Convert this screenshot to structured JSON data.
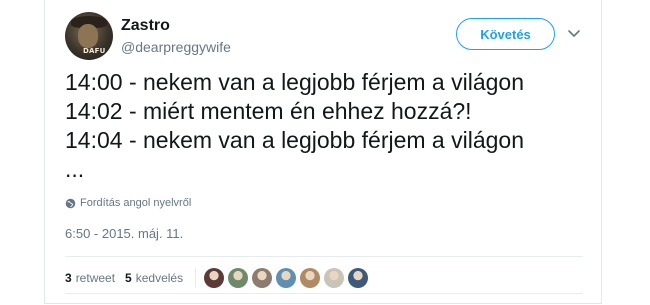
{
  "tweet": {
    "author": {
      "name": "Zastro",
      "handle": "@dearpreggywife",
      "avatar_label": "DAFU"
    },
    "follow_label": "Követés",
    "lines": [
      "14:00 - nekem van a legjobb férjem a világon",
      "14:02 - miért mentem én ehhez hozzá?!",
      "14:04 - nekem van a legjobb férjem a világon",
      "..."
    ],
    "translate_label": "Fordítás angol nyelvről",
    "timestamp": "6:50 - 2015. máj. 11.",
    "stats": {
      "retweets_count": "3",
      "retweets_label": "retweet",
      "likes_count": "5",
      "likes_label": "kedvelés"
    },
    "liker_colors": [
      "#5a3b35",
      "#6f8a6a",
      "#8d7b6e",
      "#5f8fb3",
      "#b08a62",
      "#c9c4b8",
      "#3d5a7a"
    ]
  },
  "colors": {
    "accent": "#1da1f2",
    "text": "#14171a",
    "muted": "#657786"
  }
}
